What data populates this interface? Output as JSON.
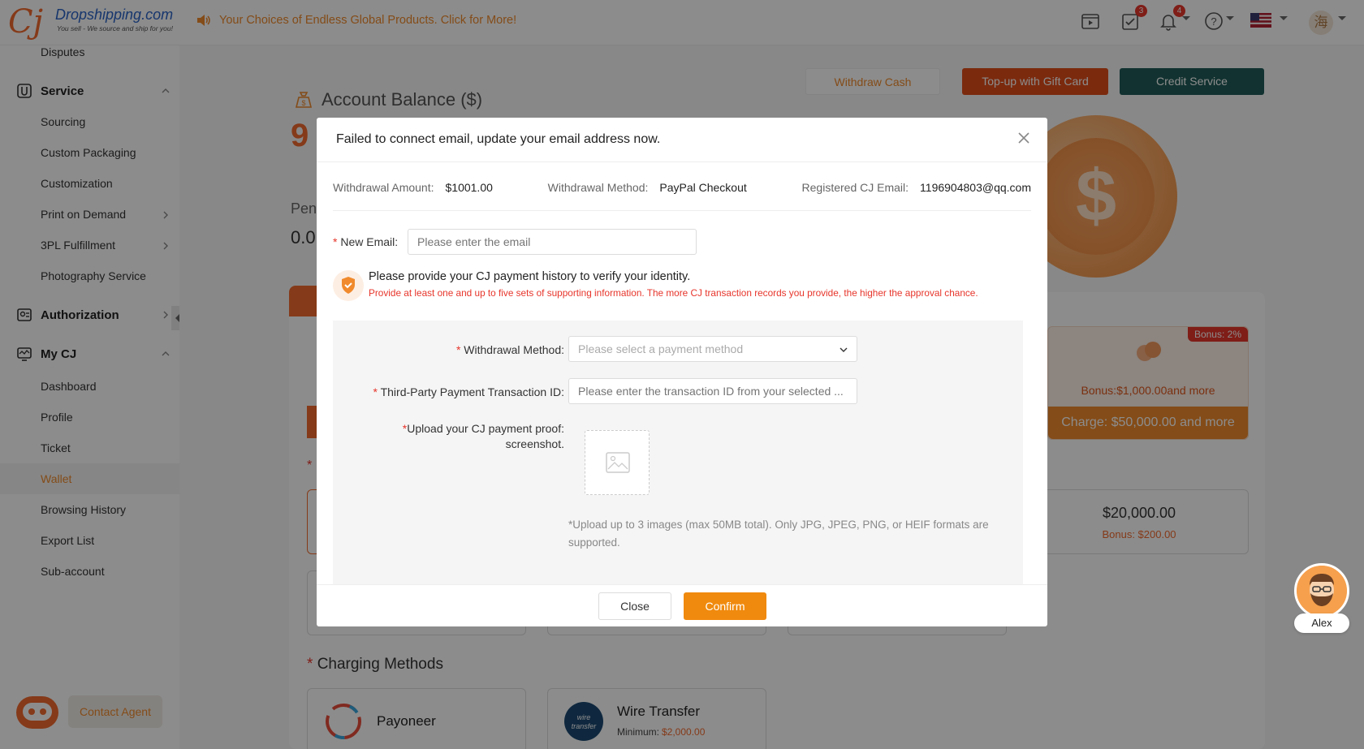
{
  "header": {
    "logo_name": "Dropshipping.com",
    "logo_tagline": "You sell - We source and ship for you!",
    "announcement": "Your Choices of Endless Global Products. Click for More!",
    "task_badge": "3",
    "notification_badge": "4",
    "avatar_char": "海"
  },
  "sidebar": {
    "disputes": "Disputes",
    "service_group": "Service",
    "service_items": [
      "Sourcing",
      "Custom Packaging",
      "Customization",
      "Print on Demand",
      "3PL Fulfillment",
      "Photography Service"
    ],
    "authorization_group": "Authorization",
    "mycj_group": "My CJ",
    "mycj_items": [
      "Dashboard",
      "Profile",
      "Ticket",
      "Wallet",
      "Browsing History",
      "Export List",
      "Sub-account"
    ],
    "active_item": "Wallet",
    "contact_agent": "Contact Agent"
  },
  "page": {
    "withdraw_cash": "Withdraw Cash",
    "topup_gift_card": "Top-up with Gift Card",
    "credit_service": "Credit Service",
    "account_balance_title": "Account Balance ($)",
    "balance_partial": "9",
    "pending_partial": "Pen",
    "pending_value_partial": "0.0",
    "bonus_tag": "Bonus: 2%",
    "bonus_text": "Bonus:$1,000.00and more",
    "charge_text": "Charge: $50,000.00 and more",
    "amount_card_value": "$20,000.00",
    "amount_card_bonus": "Bonus: $200.00",
    "charging_methods_title": "Charging Methods",
    "method_payoneer": "Payoneer",
    "method_wire": "Wire Transfer",
    "method_wire_min_label": "Minimum:",
    "method_wire_min_value": "$2,000.00",
    "wire_logo_text": "wire transfer"
  },
  "modal": {
    "title": "Failed to connect email, update your email address now.",
    "withdrawal_amount_label": "Withdrawal Amount:",
    "withdrawal_amount_value": "$1001.00",
    "withdrawal_method_label": "Withdrawal Method:",
    "withdrawal_method_value": "PayPal Checkout",
    "registered_email_label": "Registered CJ Email:",
    "registered_email_value": "1196904803@qq.com",
    "new_email_label": "New Email",
    "new_email_placeholder": "Please enter the email",
    "verify_main": "Please provide your CJ payment history to verify your identity.",
    "verify_sub": "Provide at least one and up to five sets of supporting information. The more CJ transaction records you provide, the higher the approval chance.",
    "method_label": "Withdrawal Method",
    "method_placeholder": "Please select a payment method",
    "txn_label": "Third-Party Payment Transaction ID",
    "txn_placeholder": "Please enter the transaction ID from your selected ...",
    "upload_label_line1": "Upload your CJ payment proof",
    "upload_label_line2": "screenshot.",
    "upload_hint": "*Upload up to 3 images (max 50MB total). Only JPG, JPEG, PNG, or HEIF formats are supported.",
    "close_button": "Close",
    "confirm_button": "Confirm"
  },
  "agent": {
    "name": "Alex"
  },
  "colors": {
    "accent": "#f08a0e",
    "brand_orange": "#f26b2e",
    "credit_green": "#1f5c58",
    "error_red": "#e7352b"
  }
}
